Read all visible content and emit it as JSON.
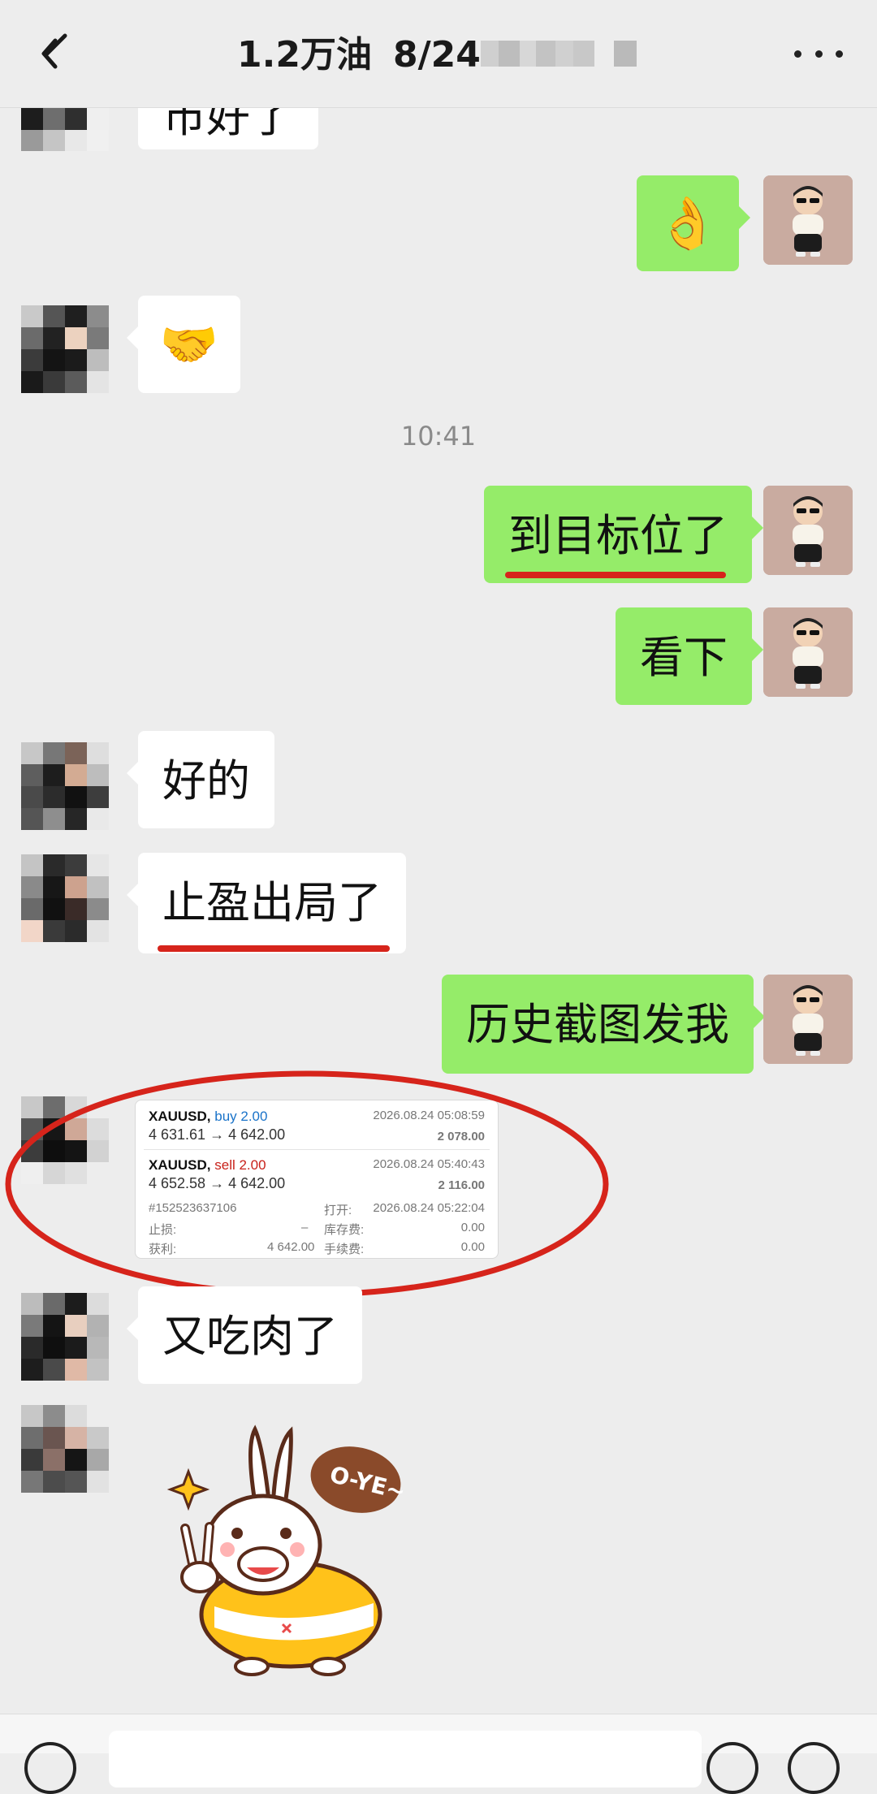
{
  "header": {
    "title_main": "1.2万油",
    "title_date": "8/24",
    "blur_colors": [
      "#bdbdbd",
      "#cfcfcf",
      "#b8b8b8",
      "#d4d4d4",
      "#c4c4c4"
    ]
  },
  "colors": {
    "background": "#ededed",
    "my_bubble": "#95ec69",
    "their_bubble": "#ffffff",
    "highlight_red": "#d6241b"
  },
  "messages": [
    {
      "side": "left",
      "text": "市好了"
    },
    {
      "side": "right",
      "emoji": "👌"
    },
    {
      "side": "left",
      "emoji": "🤝"
    },
    {
      "time": "10:41"
    },
    {
      "side": "right",
      "text": "到目标位了",
      "underlined": true
    },
    {
      "side": "right",
      "text": "看下"
    },
    {
      "side": "left",
      "text": "好的"
    },
    {
      "side": "left",
      "text": "止盈出局了",
      "underlined": true
    },
    {
      "side": "right",
      "text": "历史截图发我"
    },
    {
      "side": "left",
      "type": "trade_screenshot"
    },
    {
      "side": "left",
      "text": "又吃肉了"
    },
    {
      "side": "left",
      "type": "sticker",
      "sticker_text": "O-YE~"
    }
  ],
  "trade_card": {
    "row1": {
      "symbol": "XAUUSD,",
      "direction": "buy 2.00",
      "datetime": "2026.08.24 05:08:59",
      "prices": "4 631.61 → 4 642.00",
      "profit": "2 078.00"
    },
    "row2": {
      "symbol": "XAUUSD,",
      "direction": "sell 2.00",
      "datetime": "2026.08.24 05:40:43",
      "prices": "4 652.58 → 4 642.00",
      "profit": "2 116.00"
    },
    "order_id": "#152523637106",
    "open_label": "打开:",
    "open_time": "2026.08.24 05:22:04",
    "sl_label": "止损:",
    "sl_value": "–",
    "swap_label": "库存费:",
    "swap_value": "0.00",
    "tp_label": "获利:",
    "tp_value": "4 642.00",
    "fee_label": "手续费:",
    "fee_value": "0.00"
  },
  "icons": {
    "back": "back-arrow-icon",
    "more": "more-dots-icon",
    "voice": "voice-icon",
    "emoji": "emoji-icon",
    "plus": "plus-icon"
  }
}
